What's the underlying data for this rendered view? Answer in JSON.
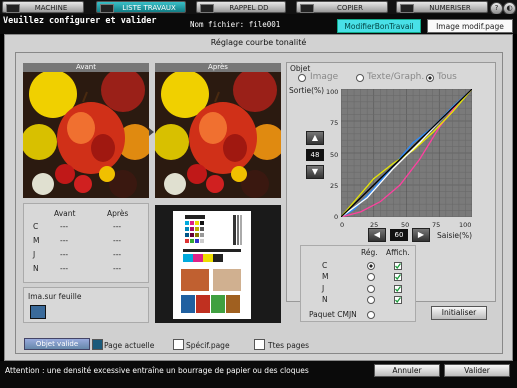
{
  "topbar": {
    "tabs": [
      {
        "label": "MACHINE"
      },
      {
        "label": "LISTE TRAVAUX"
      },
      {
        "label": "RAPPEL DD"
      },
      {
        "label": "COPIER"
      },
      {
        "label": "NUMERISER"
      }
    ],
    "right_icons": [
      "help-icon",
      "contrast-icon"
    ]
  },
  "header": {
    "title": "Veuillez configurer et valider",
    "filename": "Nom fichier: file001",
    "btn_modif": "ModifierBonTravail",
    "btn_image": "Image modif.page"
  },
  "main": {
    "title": "Réglage courbe tonalité",
    "before": "Avant",
    "after": "Après"
  },
  "density": {
    "col_before": "Avant",
    "col_after": "Après",
    "rows": [
      {
        "ch": "C",
        "before": "---",
        "after": "---"
      },
      {
        "ch": "M",
        "before": "---",
        "after": "---"
      },
      {
        "ch": "J",
        "before": "---",
        "after": "---"
      },
      {
        "ch": "N",
        "before": "---",
        "after": "---"
      }
    ]
  },
  "sheet": {
    "label": "Ima.sur feuille"
  },
  "objet": {
    "label": "Objet",
    "options": [
      "Image",
      "Texte/Graph.",
      "Tous"
    ],
    "selected": "Tous"
  },
  "graph": {
    "ylabel": "Sortie(%)",
    "xlabel": "Saisie(%)",
    "yticks": [
      "100",
      "75",
      "50",
      "25",
      "0"
    ],
    "xticks": [
      "0",
      "25",
      "50",
      "75",
      "100"
    ],
    "output_value": "48",
    "input_value": "60"
  },
  "channels": {
    "col_reg": "Rég.",
    "col_aff": "Affich.",
    "rows": [
      {
        "label": "C",
        "reg": true,
        "aff": true
      },
      {
        "label": "M",
        "reg": false,
        "aff": true
      },
      {
        "label": "J",
        "reg": false,
        "aff": true
      },
      {
        "label": "N",
        "reg": false,
        "aff": true
      }
    ],
    "paquet": "Paquet CMJN"
  },
  "initialiser": "Initialiser",
  "bottom": {
    "objet_valide": "Objet valide",
    "page_actuelle": "Page actuelle",
    "specif_page": "Spécif.page",
    "ttes_pages": "Ttes pages"
  },
  "status": {
    "message": "Attention : une densité excessive entraîne un bourrage de papier ou des cloques",
    "annuler": "Annuler",
    "valider": "Valider"
  },
  "chart_data": {
    "type": "line",
    "xlabel": "Saisie(%)",
    "ylabel": "Sortie(%)",
    "xlim": [
      0,
      100
    ],
    "ylim": [
      0,
      100
    ],
    "grid": true,
    "series": [
      {
        "color": "#2a8cff",
        "points": [
          [
            0,
            0
          ],
          [
            10,
            6
          ],
          [
            25,
            22
          ],
          [
            40,
            40
          ],
          [
            55,
            58
          ],
          [
            70,
            70
          ],
          [
            85,
            86
          ],
          [
            100,
            100
          ]
        ]
      },
      {
        "color": "#ff40a0",
        "points": [
          [
            0,
            0
          ],
          [
            15,
            4
          ],
          [
            30,
            12
          ],
          [
            45,
            25
          ],
          [
            60,
            45
          ],
          [
            75,
            70
          ],
          [
            90,
            90
          ],
          [
            100,
            100
          ]
        ]
      },
      {
        "color": "#e8e800",
        "points": [
          [
            0,
            0
          ],
          [
            10,
            12
          ],
          [
            25,
            30
          ],
          [
            40,
            42
          ],
          [
            55,
            52
          ],
          [
            70,
            66
          ],
          [
            85,
            82
          ],
          [
            100,
            100
          ]
        ]
      },
      {
        "color": "#ffffff",
        "points": [
          [
            0,
            0
          ],
          [
            20,
            15
          ],
          [
            40,
            38
          ],
          [
            50,
            48
          ],
          [
            60,
            58
          ],
          [
            80,
            80
          ],
          [
            100,
            100
          ]
        ]
      },
      {
        "color": "#000000",
        "points": [
          [
            0,
            0
          ],
          [
            25,
            25
          ],
          [
            50,
            50
          ],
          [
            75,
            75
          ],
          [
            100,
            100
          ]
        ]
      }
    ]
  }
}
